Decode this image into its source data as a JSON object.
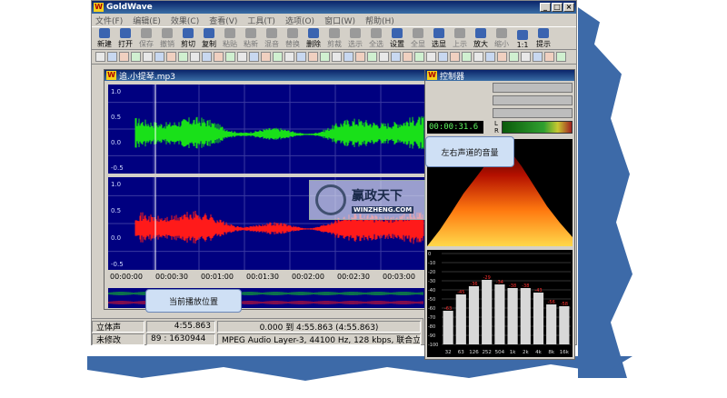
{
  "app": {
    "title": "GoldWave",
    "logo_letter": "W",
    "window_buttons": [
      "_",
      "□",
      "×"
    ]
  },
  "menu": [
    "文件(F)",
    "编辑(E)",
    "效果(C)",
    "查看(V)",
    "工具(T)",
    "选项(O)",
    "窗口(W)",
    "帮助(H)"
  ],
  "toolbar": [
    {
      "label": "新建",
      "enabled": true
    },
    {
      "label": "打开",
      "enabled": true
    },
    {
      "label": "保存",
      "enabled": false
    },
    {
      "label": "撤销",
      "enabled": false
    },
    {
      "label": "剪切",
      "enabled": true
    },
    {
      "label": "复制",
      "enabled": true
    },
    {
      "label": "粘贴",
      "enabled": false
    },
    {
      "label": "粘新",
      "enabled": false
    },
    {
      "label": "混音",
      "enabled": false
    },
    {
      "label": "替换",
      "enabled": false
    },
    {
      "label": "删除",
      "enabled": true
    },
    {
      "label": "剪裁",
      "enabled": false
    },
    {
      "label": "选示",
      "enabled": false
    },
    {
      "label": "全选",
      "enabled": false
    },
    {
      "label": "设置",
      "enabled": true
    },
    {
      "label": "全显",
      "enabled": false
    },
    {
      "label": "选显",
      "enabled": true
    },
    {
      "label": "上示",
      "enabled": false
    },
    {
      "label": "放大",
      "enabled": true
    },
    {
      "label": "缩小",
      "enabled": false
    },
    {
      "label": "1:1",
      "enabled": true
    },
    {
      "label": "提示",
      "enabled": true
    }
  ],
  "document": {
    "title": "追.小提琴.mp3",
    "top_channel": {
      "color": "#19e019",
      "ticks": [
        "1.0",
        "0.5",
        "0.0",
        "-0.5"
      ]
    },
    "bottom_channel": {
      "color": "#ff1a1a",
      "ticks": [
        "1.0",
        "0.5",
        "0.0",
        "-0.5"
      ]
    },
    "timeline": [
      "00:00:00",
      "00:00:30",
      "00:01:00",
      "00:01:30",
      "00:02:00",
      "00:02:30",
      "00:03:00"
    ]
  },
  "controller": {
    "title": "控制器",
    "clock": "00:00:31.6",
    "lr_labels": [
      "L",
      "R"
    ],
    "eq_bands": [
      "32",
      "63",
      "126",
      "252",
      "504",
      "1k",
      "2k",
      "4k",
      "8k",
      "16k"
    ],
    "eq_values": [
      -63,
      -45,
      -36,
      -29,
      -34,
      -38,
      -38,
      -43,
      -56,
      -58
    ],
    "eq_value_labels": [
      "-63",
      "-45",
      "-36",
      "-29",
      "-34",
      "-38",
      "-38",
      "-43",
      "-56",
      "-58"
    ],
    "eq_scale": [
      "0",
      "-10",
      "-20",
      "-30",
      "-40",
      "-50",
      "-60",
      "-70",
      "-80",
      "-90",
      "-100"
    ],
    "eq_min": -100,
    "eq_max": 0
  },
  "status": {
    "row1": {
      "channel": "立体声",
      "length": "4:55.863",
      "range": "0.000 到 4:55.863 (4:55.863)"
    },
    "row2": {
      "modified": "未修改",
      "position": "89 : 1630944",
      "format": "MPEG Audio Layer-3, 44100 Hz, 128 kbps, 联合立体声"
    }
  },
  "callouts": {
    "volume": "左右声道的音量",
    "position": "当前播放位置"
  },
  "watermark": {
    "cn": "赢政天下",
    "en": "WINZHENG.COM"
  },
  "colors": {
    "title_bar": "#0a246a",
    "wave_bg": "#000080",
    "window": "#d4d0c8",
    "shadow": "#3d6aa8"
  }
}
